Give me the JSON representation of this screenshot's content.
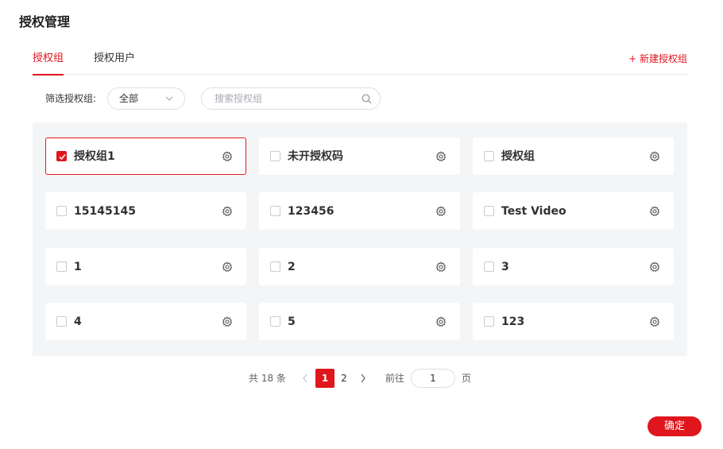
{
  "page": {
    "title": "授权管理"
  },
  "tabs": [
    {
      "label": "授权组",
      "active": true
    },
    {
      "label": "授权用户",
      "active": false
    }
  ],
  "actions": {
    "new_group_label": "+ 新建授权组",
    "confirm_label": "确定"
  },
  "filter": {
    "label": "筛选授权组:",
    "selected": "全部",
    "search_placeholder": "搜索授权组"
  },
  "groups": [
    {
      "label": "授权组1",
      "checked": true
    },
    {
      "label": "未开授权码",
      "checked": false
    },
    {
      "label": "授权组",
      "checked": false
    },
    {
      "label": "15145145",
      "checked": false
    },
    {
      "label": "123456",
      "checked": false
    },
    {
      "label": "Test Video",
      "checked": false
    },
    {
      "label": "1",
      "checked": false
    },
    {
      "label": "2",
      "checked": false
    },
    {
      "label": "3",
      "checked": false
    },
    {
      "label": "4",
      "checked": false
    },
    {
      "label": "5",
      "checked": false
    },
    {
      "label": "123",
      "checked": false
    }
  ],
  "pagination": {
    "total_text": "共 18 条",
    "pages": [
      "1",
      "2"
    ],
    "current": "1",
    "goto_label": "前往",
    "goto_value": "1",
    "page_unit": "页"
  },
  "colors": {
    "accent": "#e0161d",
    "panel_bg": "#f4f5f7"
  }
}
